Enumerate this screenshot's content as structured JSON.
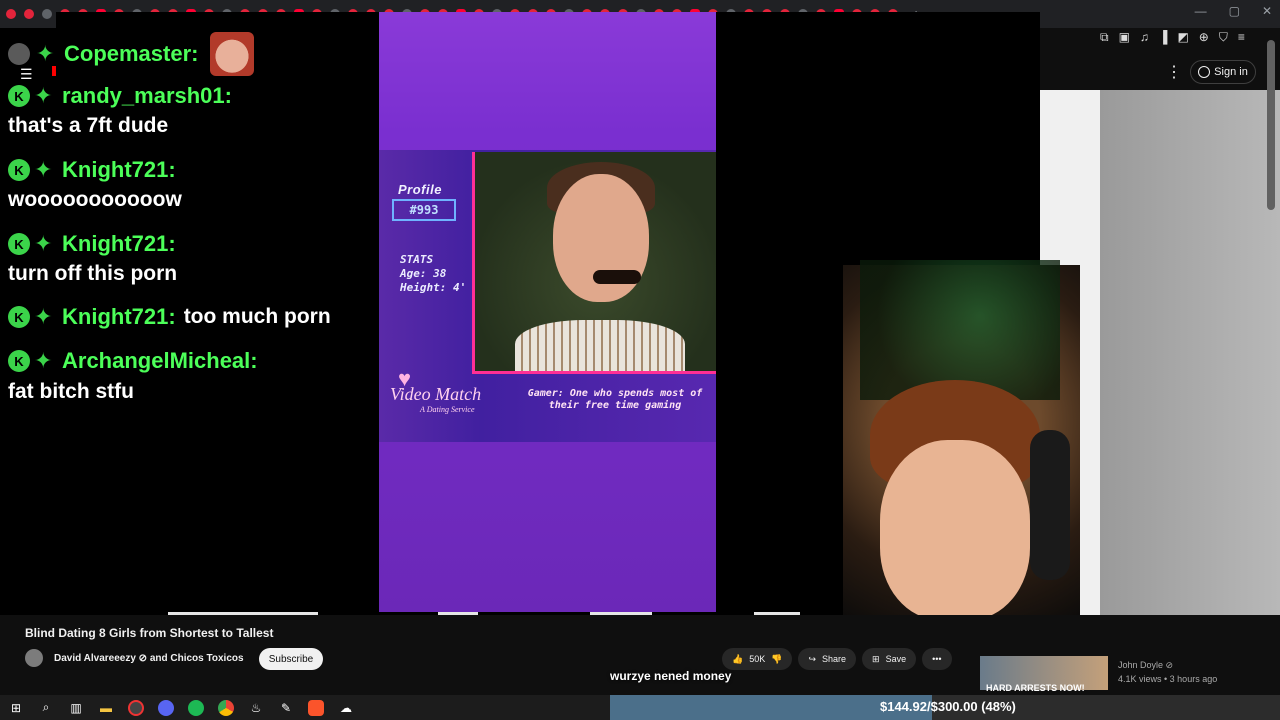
{
  "chat": {
    "messages": [
      {
        "user": "Copemaster:",
        "text": ""
      },
      {
        "user": "randy_marsh01:",
        "text": "that's a 7ft dude"
      },
      {
        "user": "Knight721:",
        "text": "wooooooooooow"
      },
      {
        "user": "Knight721:",
        "text": "turn off this porn"
      },
      {
        "user": "Knight721:",
        "text": "too much porn"
      },
      {
        "user": "ArchangelMicheal:",
        "text": "fat bitch stfu"
      }
    ],
    "badge_letter": "K"
  },
  "video_frame": {
    "profile_label": "Profile",
    "profile_number": "#993",
    "stats": [
      "STATS",
      "Age: 38",
      "Height: 4'"
    ],
    "logo": "Video Match",
    "logo_sub": "A Dating Service",
    "definition": "Gamer: One who spends most of their free time gaming"
  },
  "video_info": {
    "title": "Blind Dating 8 Girls from Shortest to Tallest",
    "channel": "David Alvareeezy ⊘ and Chicos Toxicos",
    "subscribe": "Subscribe",
    "likes": "50K",
    "share": "Share",
    "save": "Save",
    "more": "•••"
  },
  "header": {
    "sign_in": "Sign in",
    "more_icon": "⋮"
  },
  "caption": "wurzye nened money",
  "recommended": {
    "thumb_text": "HARD ARRESTS NOW!",
    "author": "John Doyle ⊘",
    "meta": "4.1K views • 3 hours ago"
  },
  "goal": {
    "text": "$144.92/$300.00 (48%)",
    "progress": 0.48
  },
  "window_controls": [
    "—",
    "▢",
    "✕"
  ]
}
